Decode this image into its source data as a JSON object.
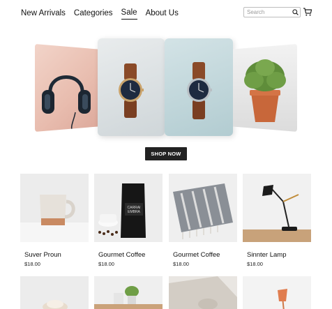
{
  "nav": {
    "items": [
      {
        "label": "New Arrivals",
        "active": false
      },
      {
        "label": "Categories",
        "active": false
      },
      {
        "label": "Sale",
        "active": true
      },
      {
        "label": "About Us",
        "active": false
      }
    ]
  },
  "search": {
    "placeholder": "Search",
    "icon": "search-icon"
  },
  "cart": {
    "icon": "cart-icon"
  },
  "hero": {
    "slides": [
      "headphones",
      "watch",
      "watch",
      "potted-plant"
    ],
    "cta_label": "SHOP NOW"
  },
  "products": [
    {
      "name": "Suver Proun",
      "price": "$18.00"
    },
    {
      "name": "Gourmet Coffee",
      "price": "$18.00"
    },
    {
      "name": "Gourmet Coffee",
      "price": "$18.00"
    },
    {
      "name": "Sinnter Lamp",
      "price": "$18.00"
    }
  ],
  "colors": {
    "button": "#222222",
    "text": "#111111",
    "border": "#bdbdbd"
  }
}
